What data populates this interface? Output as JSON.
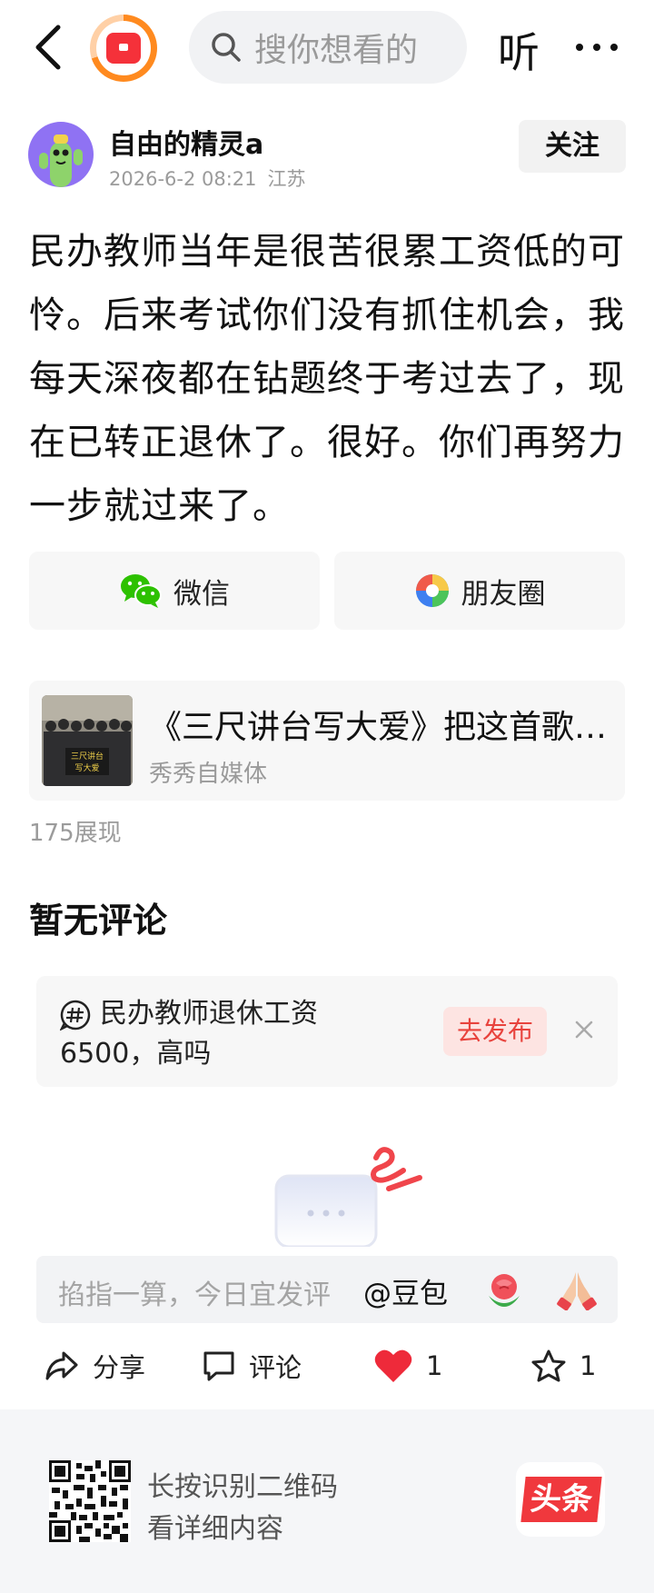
{
  "topbar": {
    "search_placeholder": "搜你想看的",
    "listen_label": "听"
  },
  "author": {
    "name": "自由的精灵a",
    "date": "2026-6-2 08:21",
    "location": "江苏",
    "follow_label": "关注"
  },
  "post": {
    "body": "民办教师当年是很苦很累工资低的可怜。后来考试你们没有抓住机会，我每天深夜都在钻题终于考过去了，现在已转正退休了。很好。你们再努力一步就过来了。"
  },
  "share": {
    "wechat_label": "微信",
    "moments_label": "朋友圈"
  },
  "linked_article": {
    "title": "《三尺讲台写大爱》把这首歌送给民办教师",
    "source": "秀秀自媒体",
    "thumb_text_1": "三尺讲台",
    "thumb_text_2": "写大爱"
  },
  "stats": {
    "views": "175展现"
  },
  "comments": {
    "empty_title": "暂无评论"
  },
  "topic": {
    "text": "民办教师退休工资6500，高吗",
    "publish_label": "去发布"
  },
  "comment_input": {
    "placeholder": "掐指一算，今日宜发评",
    "mention": "@豆包"
  },
  "actions": {
    "share_label": "分享",
    "comment_label": "评论",
    "like_count": "1",
    "favorite_count": "1"
  },
  "footer": {
    "line1": "长按识别二维码",
    "line2": "看详细内容",
    "brand": "头条"
  },
  "colors": {
    "accent_red": "#e8433d",
    "like_red": "#ee2a3a",
    "wechat_green": "#2dc100",
    "avatar_purple": "#8f72f3"
  }
}
